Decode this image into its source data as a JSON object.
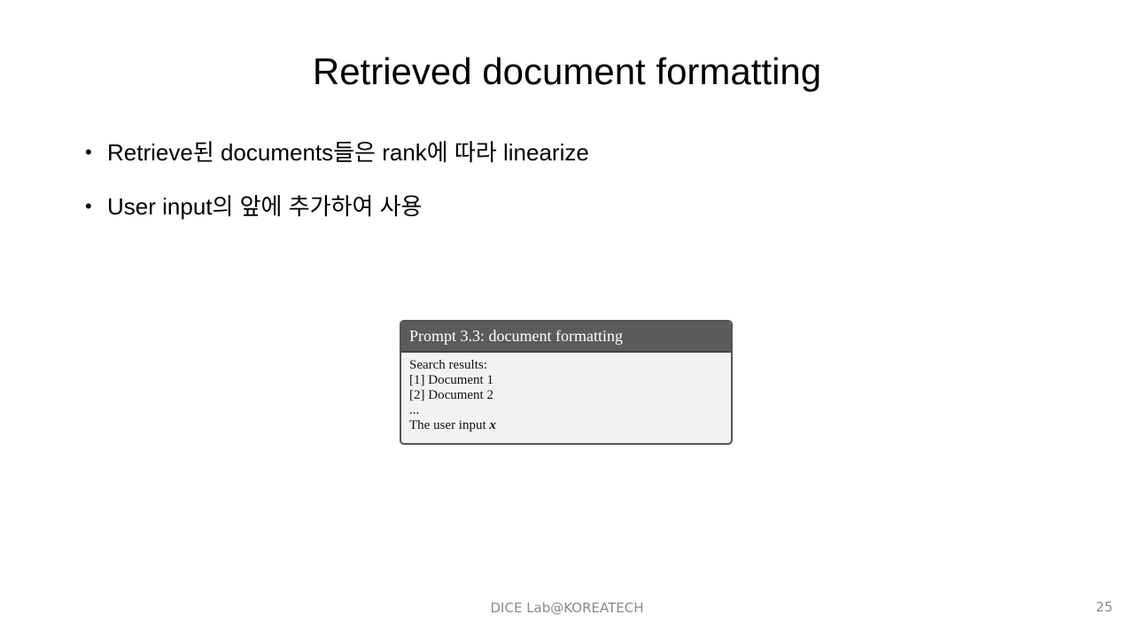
{
  "slide": {
    "title": "Retrieved document formatting",
    "bullets": [
      {
        "symbol": "•",
        "text": "Retrieve된 documents들은 rank에 따라 linearize"
      },
      {
        "symbol": "•",
        "text": "User input의 앞에 추가하여 사용"
      }
    ]
  },
  "prompt_box": {
    "header": "Prompt 3.3: document formatting",
    "lines": [
      "Search results:",
      "[1] Document 1",
      "[2] Document 2",
      "..."
    ],
    "last_line_prefix": "The user input ",
    "last_line_var": "x"
  },
  "footer": {
    "text": "DICE Lab@KOREATECH",
    "page_number": "25"
  }
}
